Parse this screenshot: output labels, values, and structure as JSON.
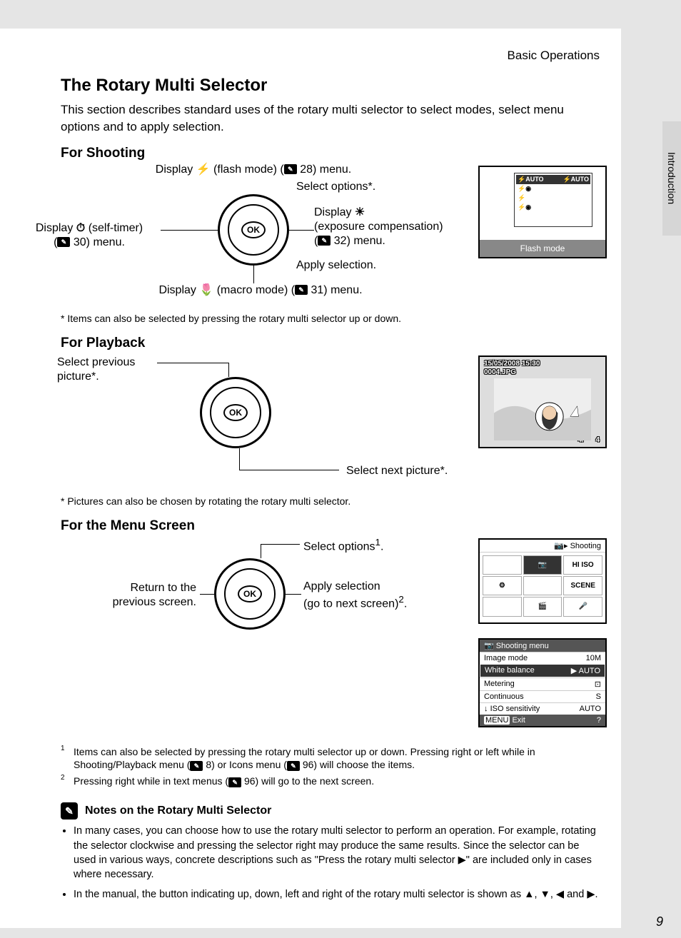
{
  "side_tab": "Introduction",
  "breadcrumb": "Basic Operations",
  "title": "The Rotary Multi Selector",
  "intro": "This section describes standard uses of the rotary multi selector to select modes, select menu options and to apply selection.",
  "page_number": "9",
  "shooting": {
    "heading": "For Shooting",
    "top_label_pre": "Display ",
    "top_label_post": " (flash mode) (",
    "top_label_ref": "28) menu.",
    "right_top": "Select options*.",
    "right_mid_pre": "Display ",
    "right_mid_line2": "(exposure compensation)",
    "right_mid_line3_pre": "(",
    "right_mid_line3_post": " 32) menu.",
    "left_pre": "Display ",
    "left_post": " (self-timer)",
    "left_line2_pre": "(",
    "left_line2_post": " 30) menu.",
    "bottom_mid": "Apply selection.",
    "bottom_label_pre": "Display ",
    "bottom_label_post": " (macro mode) (",
    "bottom_label_ref": " 31) menu.",
    "footnote": "*   Items can also be selected by pressing the rotary multi selector up or down.",
    "flash_caption": "Flash mode",
    "flash_rows": [
      "⚡AUTO",
      "⚡◉",
      "⚡",
      "⚡◉"
    ],
    "flash_off": "⚡AUTO"
  },
  "playback": {
    "heading": "For Playback",
    "left_label": "Select previous picture*.",
    "right_label": "Select next picture*.",
    "footnote": "*   Pictures can also be chosen by rotating the rotary multi selector.",
    "screen_date": "15/05/2008 15:30",
    "screen_file": "0004.JPG",
    "screen_count": "4/",
    "screen_total": "4"
  },
  "menu": {
    "heading": "For the Menu Screen",
    "top_label": "Select options",
    "top_sup": "1",
    "top_post": ".",
    "left_label": "Return to the previous screen.",
    "right_label_l1": "Apply selection",
    "right_label_l2_pre": "(go to next screen)",
    "right_sup": "2",
    "right_post": ".",
    "footnote1_pre": "Items can also be selected by pressing the rotary multi selector up or down. Pressing right or left while in Shooting/Playback menu (",
    "footnote1_mid": " 8) or Icons menu (",
    "footnote1_post": " 96) will choose the items.",
    "footnote2_pre": "Pressing right while in text menus (",
    "footnote2_post": " 96) will go to the next screen.",
    "shoot_title": "Shooting",
    "shoot_cells": [
      "",
      "📷",
      "HI ISO",
      "⚙",
      "",
      "SCENE",
      "",
      "🎬",
      "🎤"
    ],
    "menu_title": "Shooting menu",
    "menu_items": [
      {
        "label": "Image mode",
        "val": "10M"
      },
      {
        "label": "White balance",
        "val": "AUTO"
      },
      {
        "label": "Metering",
        "val": "⊡"
      },
      {
        "label": "Continuous",
        "val": "S"
      },
      {
        "label": "ISO sensitivity",
        "val": "AUTO"
      }
    ],
    "menu_exit": "Exit",
    "menu_exit_btn": "MENU",
    "menu_help": "?"
  },
  "notes": {
    "heading": "Notes on the Rotary Multi Selector",
    "bullet1": "In many cases, you can choose how to use the rotary multi selector to perform an operation. For example, rotating the selector clockwise and pressing the selector right may produce the same results. Since the selector can be used in various ways, concrete descriptions such as \"Press the rotary multi selector ▶\" are included only in cases where necessary.",
    "bullet2": "In the manual, the button indicating up, down, left and right of the rotary multi selector is shown as ▲, ▼, ◀ and ▶."
  },
  "ok_label": "OK"
}
